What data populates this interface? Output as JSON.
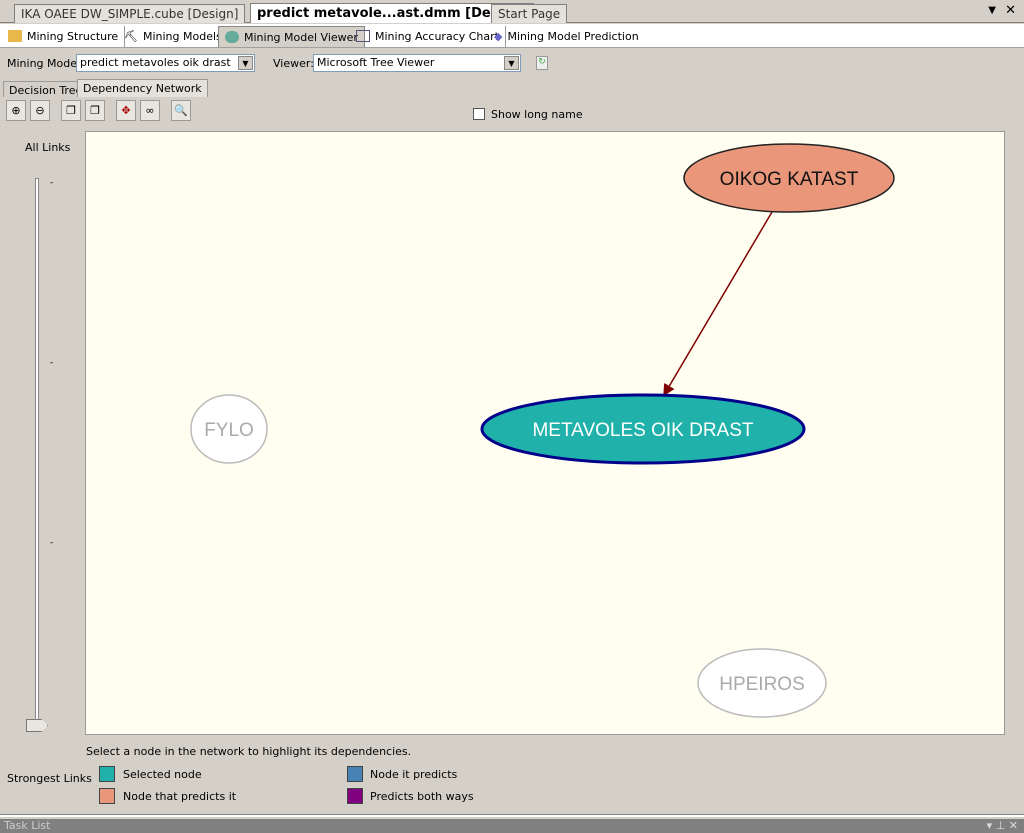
{
  "doc_tabs": [
    "IKA OAEE DW_SIMPLE.cube [Design]",
    "predict metavole...ast.dmm [Design]",
    "Start Page"
  ],
  "designer_tabs": [
    "Mining Structure",
    "Mining Models",
    "Mining Model Viewer",
    "Mining Accuracy Chart",
    "Mining Model Prediction"
  ],
  "mining_model": {
    "label": "Mining Model:",
    "value": "predict metavoles oik drast"
  },
  "viewer": {
    "label": "Viewer:",
    "value": "Microsoft Tree Viewer"
  },
  "view_tabs": [
    "Decision Tree",
    "Dependency Network"
  ],
  "show_long_name": "Show long name",
  "slider": {
    "top_label": "All Links",
    "bottom_label": "Strongest Links",
    "level": 0
  },
  "nodes": {
    "oikog": "OIKOG KATAST",
    "metavoles": "METAVOLES OIK DRAST",
    "fylo": "FYLO",
    "hpeiros": "HPEIROS"
  },
  "hint": "Select a node in the network to highlight its dependencies.",
  "legend": [
    {
      "label": "Selected node",
      "color": "#20b2aa"
    },
    {
      "label": "Node that predicts it",
      "color": "#e9967a"
    },
    {
      "label": "Node it predicts",
      "color": "#4682b4"
    },
    {
      "label": "Predicts both ways",
      "color": "#800080"
    }
  ],
  "task_list": "Task List"
}
